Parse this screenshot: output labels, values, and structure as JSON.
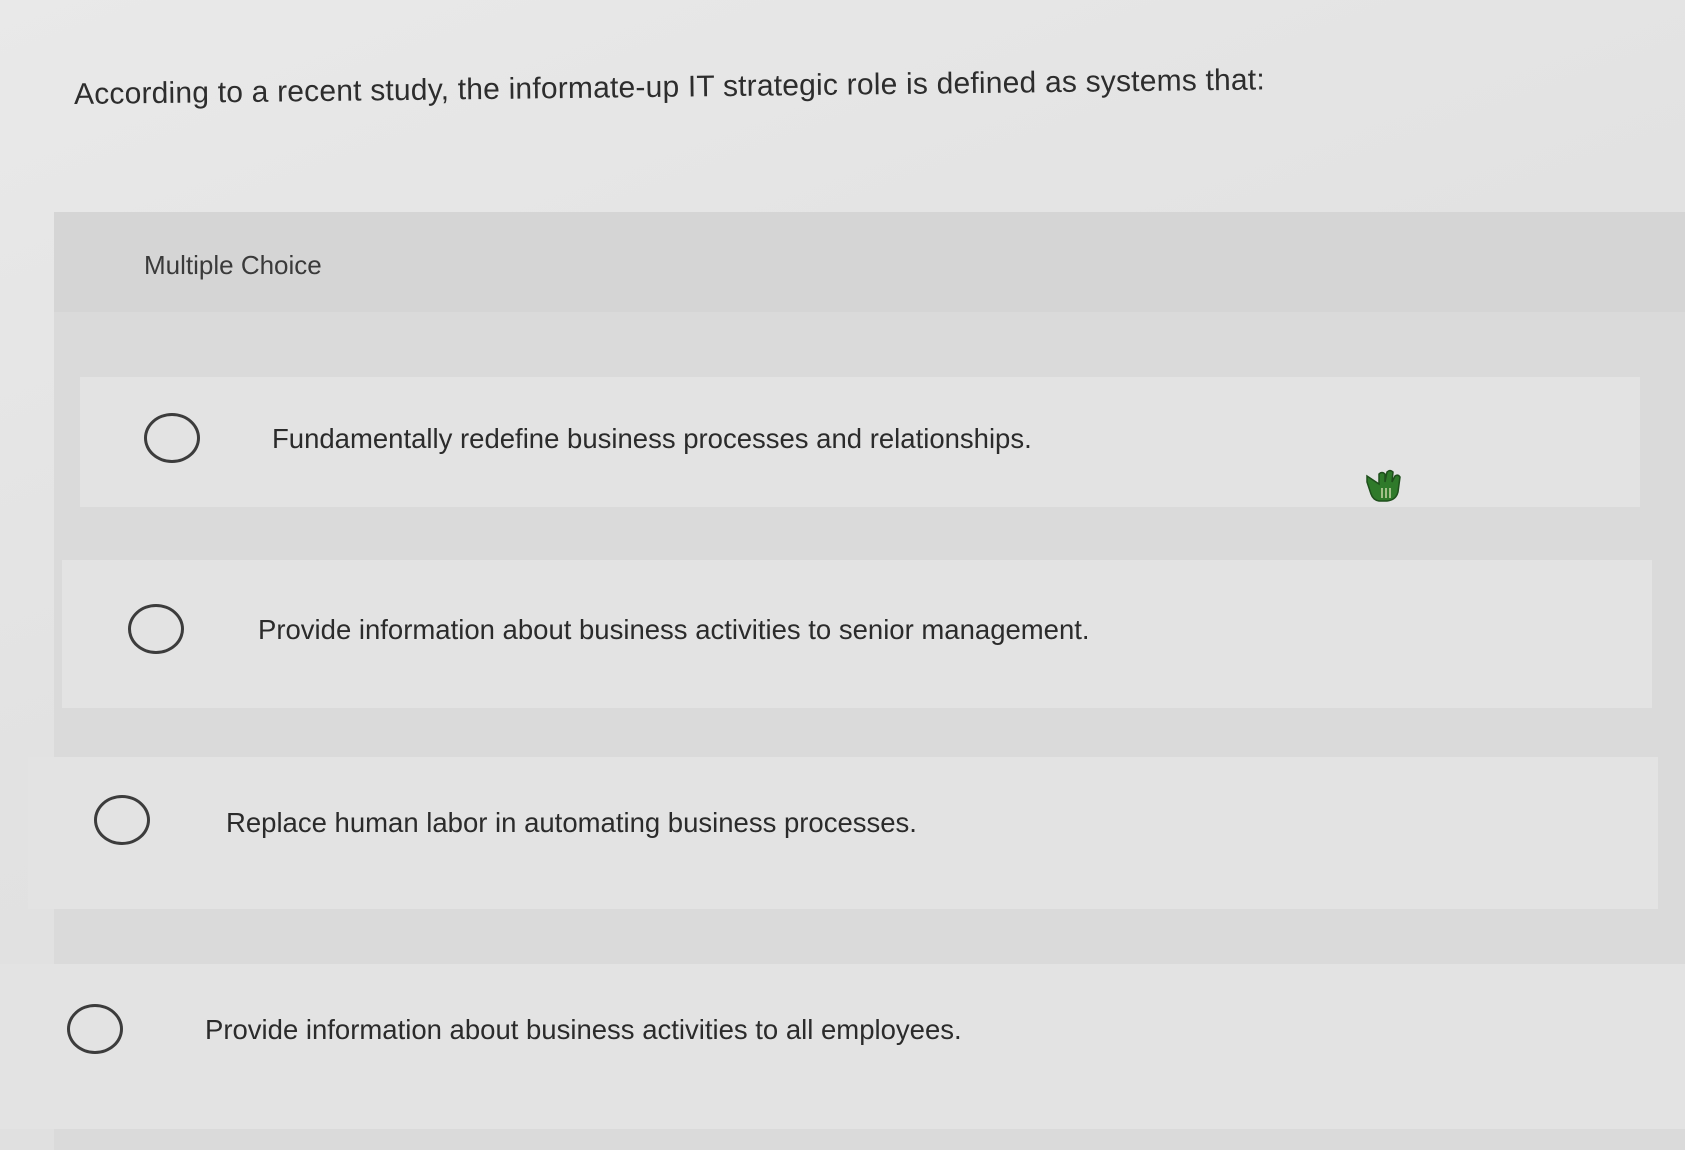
{
  "question": {
    "text": "According to a recent study, the informate-up IT strategic role is defined as systems that:"
  },
  "choices": {
    "header": "Multiple Choice",
    "options": [
      {
        "label": "Fundamentally redefine business processes and relationships.",
        "selected": false
      },
      {
        "label": "Provide information about business activities to senior management.",
        "selected": false
      },
      {
        "label": "Replace human labor in automating business processes.",
        "selected": false
      },
      {
        "label": "Provide information about business activities to all employees.",
        "selected": false
      }
    ]
  },
  "icons": {
    "radio": "radio-button-icon",
    "cursor": "hand-pointer-icon"
  },
  "colors": {
    "background": "#e6e6e6",
    "panel": "#dadada",
    "option_row": "#e3e3e3",
    "text": "#2d2d2d",
    "cursor": "#2f7a2a"
  }
}
